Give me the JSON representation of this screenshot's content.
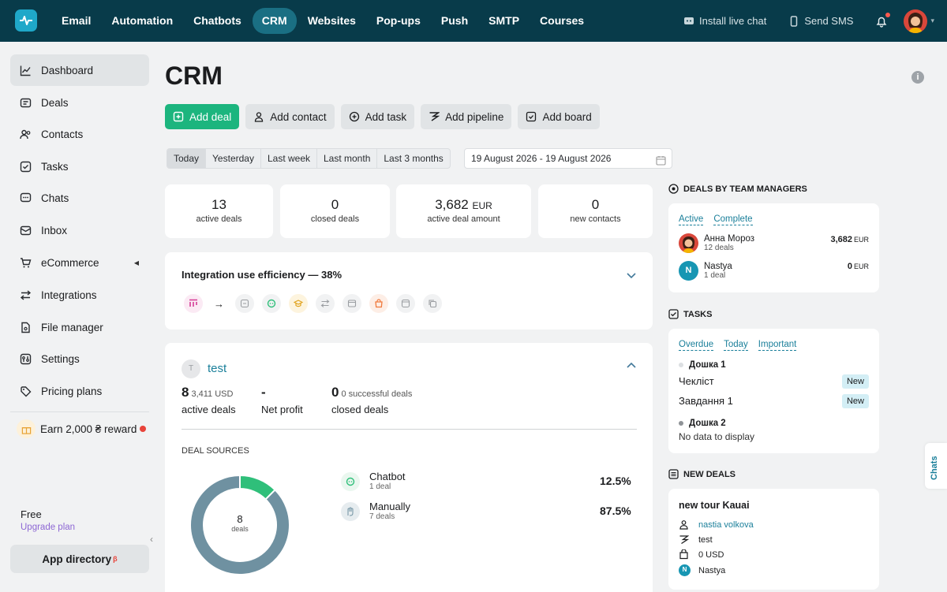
{
  "nav": {
    "items": [
      "Email",
      "Automation",
      "Chatbots",
      "CRM",
      "Websites",
      "Pop-ups",
      "Push",
      "SMTP",
      "Courses"
    ],
    "active": "CRM",
    "install_chat": "Install live chat",
    "send_sms": "Send SMS"
  },
  "sidebar": {
    "items": [
      {
        "label": "Dashboard",
        "icon": "chart-line-icon"
      },
      {
        "label": "Deals",
        "icon": "deals-icon"
      },
      {
        "label": "Contacts",
        "icon": "contacts-icon"
      },
      {
        "label": "Tasks",
        "icon": "tasks-icon"
      },
      {
        "label": "Chats",
        "icon": "chat-icon"
      },
      {
        "label": "Inbox",
        "icon": "inbox-icon"
      },
      {
        "label": "eCommerce",
        "icon": "cart-icon"
      },
      {
        "label": "Integrations",
        "icon": "integrations-icon"
      },
      {
        "label": "File manager",
        "icon": "file-icon"
      },
      {
        "label": "Settings",
        "icon": "settings-icon"
      },
      {
        "label": "Pricing plans",
        "icon": "pricing-icon"
      }
    ],
    "reward": "Earn 2,000 ₴ reward",
    "plan": "Free",
    "upgrade": "Upgrade plan",
    "app_directory": "App directory",
    "app_directory_sup": "β"
  },
  "page": {
    "title": "CRM",
    "buttons": [
      "Add deal",
      "Add contact",
      "Add task",
      "Add pipeline",
      "Add board"
    ],
    "periods": [
      "Today",
      "Yesterday",
      "Last week",
      "Last month",
      "Last 3 months"
    ],
    "active_period": "Today",
    "date_range": "19 August 2026 - 19 August 2026"
  },
  "stats": [
    {
      "value": "13",
      "unit": "",
      "label": "active deals"
    },
    {
      "value": "0",
      "unit": "",
      "label": "closed deals"
    },
    {
      "value": "3,682",
      "unit": "EUR",
      "label": "active deal amount"
    },
    {
      "value": "0",
      "unit": "",
      "label": "new contacts"
    }
  ],
  "efficiency": {
    "title": "Integration use efficiency — 38%"
  },
  "pipeline": {
    "avatar_letter": "T",
    "name": "test",
    "active_count": "8",
    "active_amount": "3,411 USD",
    "active_label": "active deals",
    "net_profit": "-",
    "net_profit_label": "Net profit",
    "closed_count": "0",
    "closed_sub": "0 successful deals",
    "closed_label": "closed deals",
    "deal_sources_title": "DEAL SOURCES",
    "donut_total": "8",
    "donut_label": "deals"
  },
  "chart_data": {
    "type": "pie",
    "categories": [
      "Chatbot",
      "Manually"
    ],
    "values": [
      12.5,
      87.5
    ],
    "counts": [
      "1 deal",
      "7 deals"
    ],
    "labels": [
      "12.5%",
      "87.5%"
    ],
    "colors": [
      "#2fbf7a",
      "#6f91a1"
    ]
  },
  "managers": {
    "title": "DEALS BY TEAM MANAGERS",
    "tabs": [
      "Active",
      "Complete"
    ],
    "rows": [
      {
        "name": "Анна Мороз",
        "sub": "12 deals",
        "amount": "3,682",
        "unit": "EUR"
      },
      {
        "name": "Nastya",
        "sub": "1 deal",
        "amount": "0",
        "unit": "EUR",
        "initial": "N"
      }
    ]
  },
  "tasks": {
    "title": "TASKS",
    "tabs": [
      "Overdue",
      "Today",
      "Important"
    ],
    "board1": "Дошка 1",
    "task1": "Чекліст",
    "task2": "Завдання 1",
    "badge": "New",
    "board2": "Дошка 2",
    "nodata": "No data to display"
  },
  "new_deals": {
    "title": "NEW DEALS",
    "deal_title": "new tour Kauai",
    "contact": "nastia volkova",
    "pipeline": "test",
    "amount": "0 USD",
    "manager": "Nastya",
    "manager_initial": "N"
  },
  "chats_tab": "Chats"
}
